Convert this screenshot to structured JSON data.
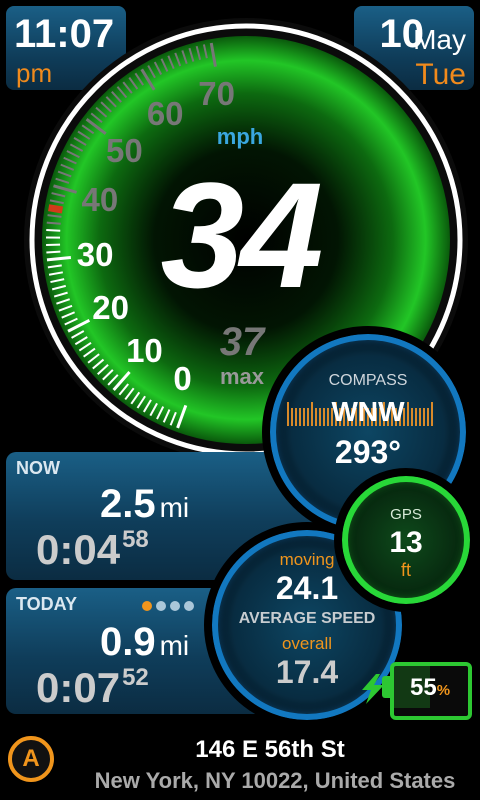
{
  "clock": {
    "time": "11:07",
    "ampm": "pm"
  },
  "date": {
    "day": "10",
    "month": "May",
    "weekday": "Tue"
  },
  "speedometer": {
    "unit": "mph",
    "speed": "34",
    "max_value": "37",
    "max_label": "max",
    "ticks": [
      "0",
      "10",
      "20",
      "30",
      "40",
      "50",
      "60",
      "70"
    ],
    "needle_speed": 34,
    "max_speed_marker": 37,
    "scale_max": 70,
    "colors": {
      "active": "#2be23a",
      "tick_active": "#ffffff",
      "tick_inactive": "#777777",
      "max_marker": "#d23a1a"
    }
  },
  "compass": {
    "title": "COMPASS",
    "direction": "WNW",
    "degrees": "293°",
    "heading": 293
  },
  "gps": {
    "title": "GPS",
    "accuracy": "13",
    "unit": "ft"
  },
  "now": {
    "title": "NOW",
    "distance": "2.5",
    "distance_unit": "mi",
    "time": "0:04",
    "time_seconds": "58"
  },
  "today": {
    "title": "TODAY",
    "distance": "0.9",
    "distance_unit": "mi",
    "time": "0:07",
    "time_seconds": "52",
    "page_count": 4,
    "page_active": 1
  },
  "average_speed": {
    "moving_label": "moving",
    "moving": "24.1",
    "title": "AVERAGE SPEED",
    "overall_label": "overall",
    "overall": "17.4"
  },
  "battery": {
    "level": 0.55,
    "value": "55",
    "unit": "%",
    "icon": "charging-bolt-icon"
  },
  "address": {
    "status_icon_letter": "A",
    "street": "146 E 56th St",
    "city": "New York, NY 10022, United States"
  }
}
